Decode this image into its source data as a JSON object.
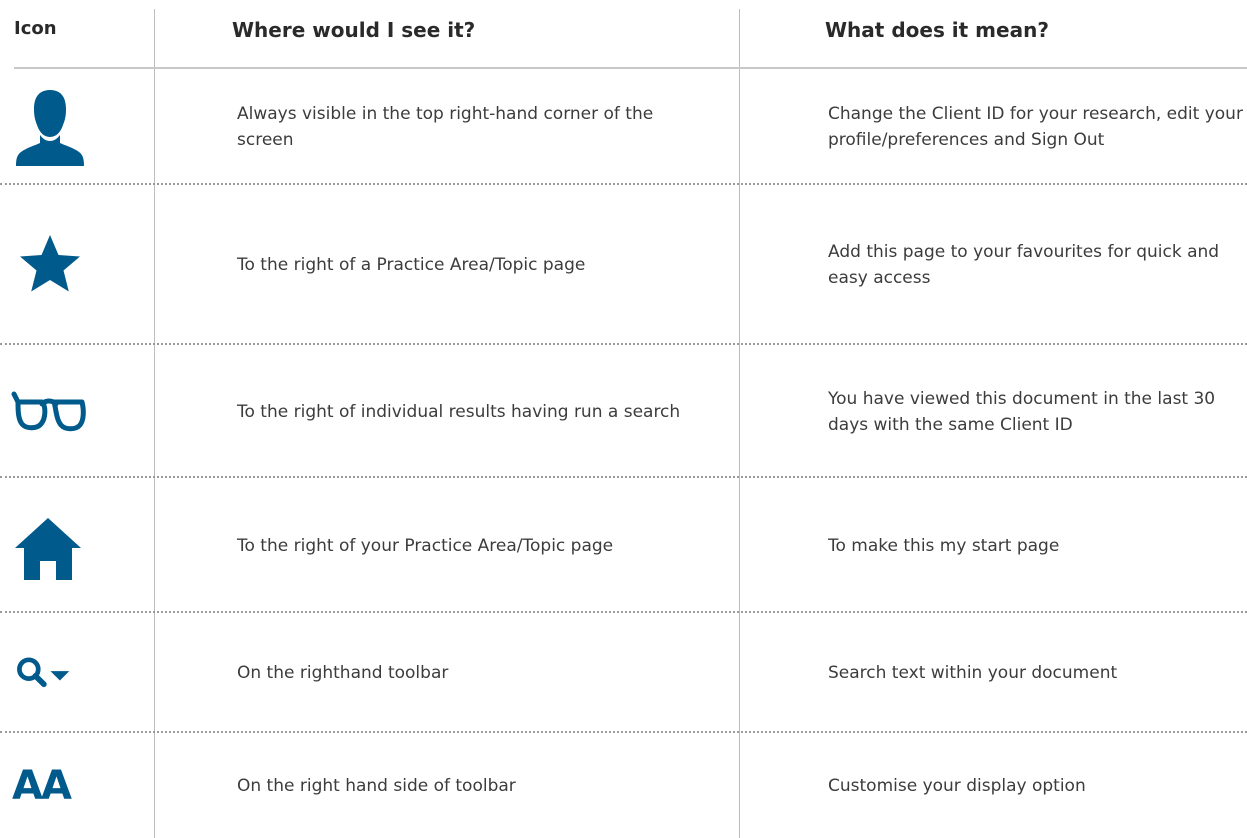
{
  "accent_color": "#005a8c",
  "headers": {
    "icon": "Icon",
    "where": "Where would I see it?",
    "what": "What does it mean?"
  },
  "rows": [
    {
      "icon": "user-profile-icon",
      "where": "Always visible in the top right-hand corner of the screen",
      "what": "Change the Client ID for your research, edit your profile/preferences and Sign Out"
    },
    {
      "icon": "star-icon",
      "where": "To the right of a Practice Area/Topic page",
      "what": "Add this page to your favourites for quick and easy access"
    },
    {
      "icon": "glasses-icon",
      "where": "To the right of individual results having run a search",
      "what": "You have viewed this document in the last 30 days with the same Client ID"
    },
    {
      "icon": "home-icon",
      "where": "To the right of your Practice Area/Topic page",
      "what": "To make this my start page"
    },
    {
      "icon": "search-dropdown-icon",
      "where": "On the righthand toolbar",
      "what": "Search text within your document"
    },
    {
      "icon": "text-size-icon",
      "icon_text": "AA",
      "where": "On the right hand side of toolbar",
      "what": "Customise your display option"
    }
  ]
}
